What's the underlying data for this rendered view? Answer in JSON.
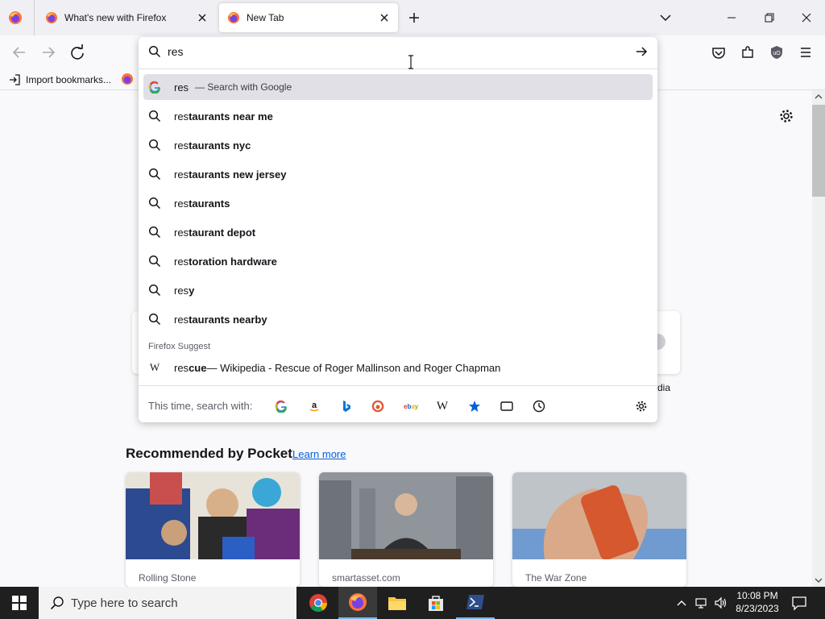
{
  "tabs": [
    {
      "title": "What's new with Firefox",
      "active": false
    },
    {
      "title": "New Tab",
      "active": true
    }
  ],
  "urlbar": {
    "value": "res"
  },
  "bookmarks": {
    "import_label": "Import bookmarks..."
  },
  "suggestions": {
    "first": {
      "typed": "res",
      "suffix": "— Search with Google"
    },
    "items": [
      {
        "typed": "res",
        "completion": "taurants near me"
      },
      {
        "typed": "res",
        "completion": "taurants nyc"
      },
      {
        "typed": "res",
        "completion": "taurants new jersey"
      },
      {
        "typed": "res",
        "completion": "taurants"
      },
      {
        "typed": "res",
        "completion": "taurant depot"
      },
      {
        "typed": "res",
        "completion": "toration hardware"
      },
      {
        "typed": "res",
        "completion": "y"
      },
      {
        "typed": "res",
        "completion": "taurants nearby"
      }
    ],
    "firefox_suggest_heading": "Firefox Suggest",
    "wiki_item": {
      "typed": "res",
      "completion": "cue",
      "rest": " — Wikipedia - Rescue of Roger Mallinson and Roger Chapman"
    },
    "search_with_label": "This time, search with:",
    "engines": [
      "google-icon",
      "amazon-icon",
      "bing-icon",
      "duckduckgo-icon",
      "ebay-icon",
      "wikipedia-icon",
      "bookmarks-star-icon",
      "tabs-icon",
      "history-icon"
    ]
  },
  "page": {
    "partial_label": "dia",
    "pocket_heading": "Recommended by Pocket",
    "learn_more": "Learn more",
    "cards": [
      {
        "source": "Rolling Stone"
      },
      {
        "source": "smartasset.com"
      },
      {
        "source": "The War Zone"
      }
    ]
  },
  "taskbar": {
    "search_placeholder": "Type here to search",
    "time": "10:08 PM",
    "date": "8/23/2023"
  },
  "colors": {
    "accent": "#0061e0",
    "google_blue": "#4285f4",
    "taskbar": "#1f1f1f"
  }
}
